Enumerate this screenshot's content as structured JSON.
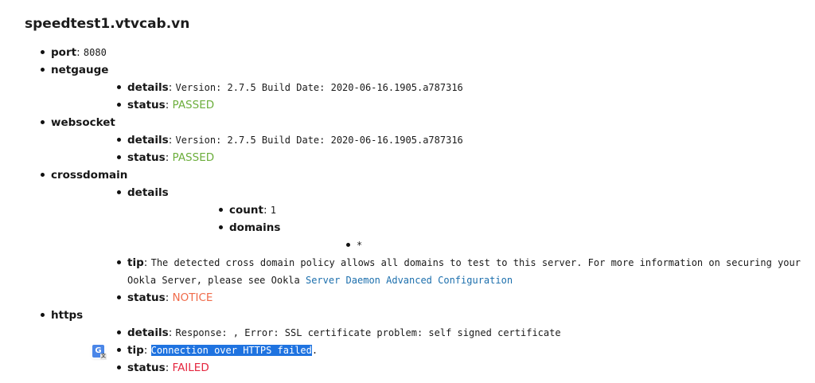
{
  "host": "speedtest1.vtvcab.vn",
  "port": {
    "key": "port",
    "value": "8080"
  },
  "netgauge": {
    "key": "netgauge",
    "details": {
      "key": "details",
      "value": "Version: 2.7.5 Build Date: 2020-06-16.1905.a787316"
    },
    "status": {
      "key": "status",
      "value": "PASSED"
    }
  },
  "websocket": {
    "key": "websocket",
    "details": {
      "key": "details",
      "value": "Version: 2.7.5 Build Date: 2020-06-16.1905.a787316"
    },
    "status": {
      "key": "status",
      "value": "PASSED"
    }
  },
  "crossdomain": {
    "key": "crossdomain",
    "details": {
      "key": "details",
      "count": {
        "key": "count",
        "value": "1"
      },
      "domains": {
        "key": "domains",
        "items": [
          "*"
        ]
      }
    },
    "tip": {
      "key": "tip",
      "value": "The detected cross domain policy allows all domains to test to this server. For more information on securing your Ookla Server, please see Ookla ",
      "link": "Server Daemon Advanced Configuration"
    },
    "status": {
      "key": "status",
      "value": "NOTICE"
    }
  },
  "https": {
    "key": "https",
    "details": {
      "key": "details",
      "value": "Response: , Error: SSL certificate problem: self signed certificate"
    },
    "tip": {
      "key": "tip",
      "selected_text": "Connection over HTTPS failed",
      "trailing": "."
    },
    "status": {
      "key": "status",
      "value": "FAILED"
    }
  },
  "colors": {
    "passed": "#6cae3c",
    "notice": "#f06b4a",
    "failed": "#e5263f",
    "link": "#1c6fad",
    "selection": "#1f73e0"
  },
  "icons": {
    "translate": "google-translate-icon"
  }
}
